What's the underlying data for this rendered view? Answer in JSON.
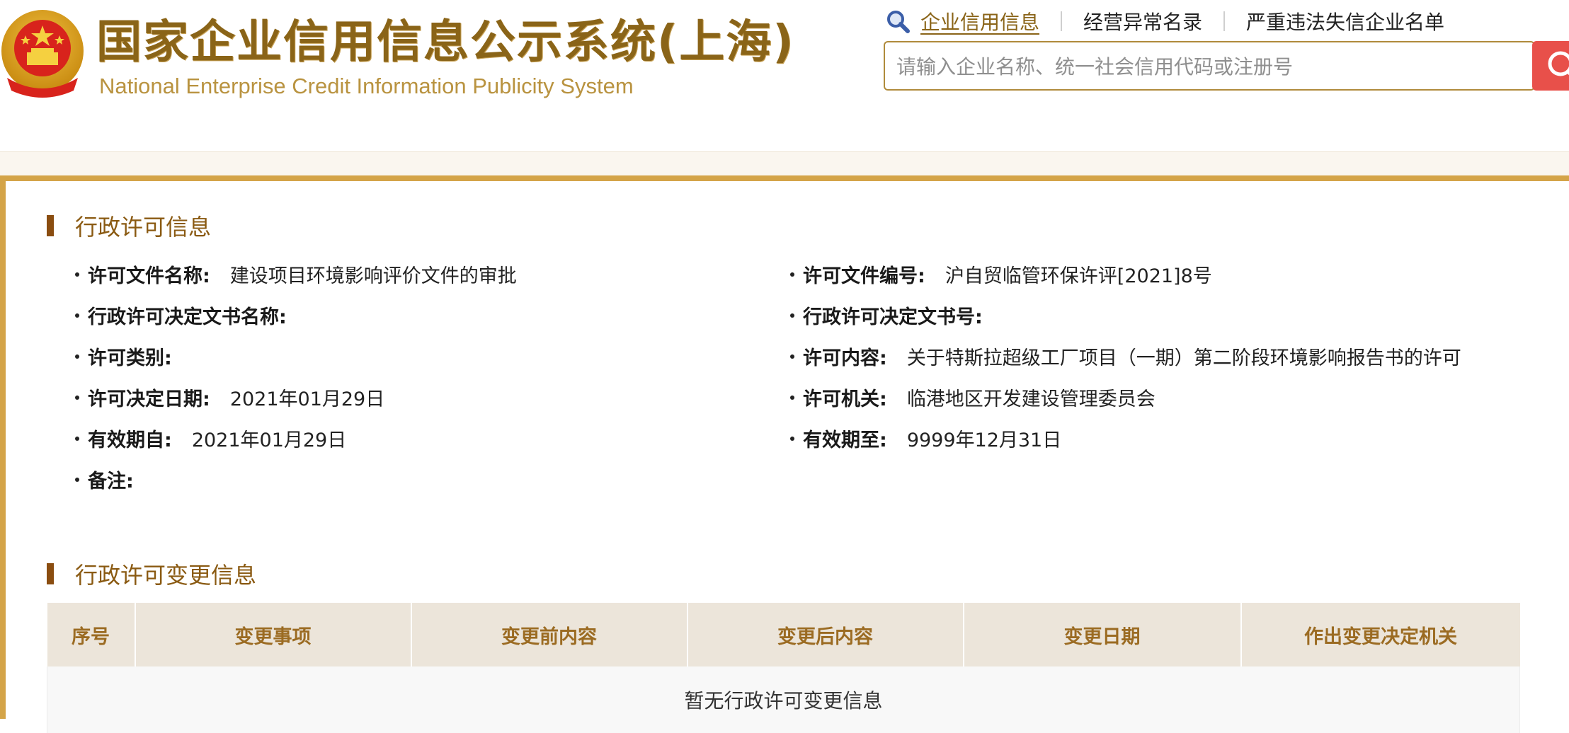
{
  "header": {
    "title": "国家企业信用信息公示系统(上海)",
    "subtitle": "National Enterprise Credit Information Publicity System",
    "nav": [
      {
        "label": "企业信用信息",
        "active": true
      },
      {
        "label": "经营异常名录",
        "active": false
      },
      {
        "label": "严重违法失信企业名单",
        "active": false
      }
    ],
    "search_placeholder": "请输入企业名称、统一社会信用代码或注册号"
  },
  "license_section": {
    "title": "行政许可信息",
    "fields": [
      {
        "label": "许可文件名称:",
        "value": "建设项目环境影响评价文件的审批"
      },
      {
        "label": "许可文件编号:",
        "value": "沪自贸临管环保许评[2021]8号"
      },
      {
        "label": "行政许可决定文书名称:",
        "value": ""
      },
      {
        "label": "行政许可决定文书号:",
        "value": ""
      },
      {
        "label": "许可类别:",
        "value": ""
      },
      {
        "label": "许可内容:",
        "value": "关于特斯拉超级工厂项目（一期）第二阶段环境影响报告书的许可"
      },
      {
        "label": "许可决定日期:",
        "value": "2021年01月29日"
      },
      {
        "label": "许可机关:",
        "value": "临港地区开发建设管理委员会"
      },
      {
        "label": "有效期自:",
        "value": "2021年01月29日"
      },
      {
        "label": "有效期至:",
        "value": "9999年12月31日"
      },
      {
        "label": "备注:",
        "value": ""
      }
    ]
  },
  "change_section": {
    "title": "行政许可变更信息",
    "columns": [
      "序号",
      "变更事项",
      "变更前内容",
      "变更后内容",
      "变更日期",
      "作出变更决定机关"
    ],
    "empty_text": "暂无行政许可变更信息"
  },
  "colors": {
    "brand_gold": "#d4a448",
    "title_brown": "#8a6418",
    "search_red": "#e8504a"
  },
  "icons": [
    "emblem-icon",
    "search-icon",
    "magnifier-icon"
  ]
}
